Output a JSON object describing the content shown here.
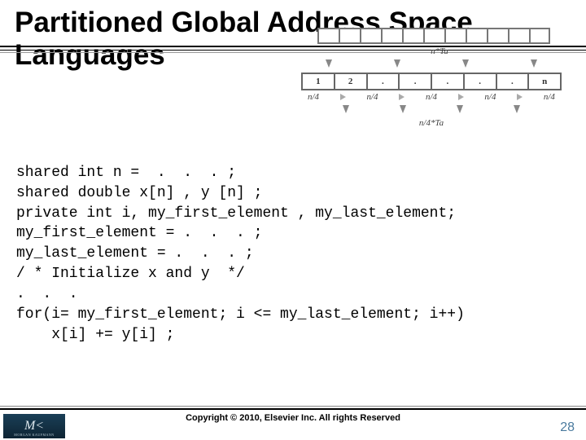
{
  "title": "Partitioned Global Address Space Languages",
  "diagram": {
    "top_label": "n*Ta",
    "mid_cells": [
      "1",
      "2",
      ".",
      ".",
      ".",
      ".",
      ".",
      "n"
    ],
    "n4_label": "n/4",
    "bottom_label": "n/4*Ta"
  },
  "code": "shared int n =  .  .  . ;\nshared double x[n] , y [n] ;\nprivate int i, my_first_element , my_last_element;\nmy_first_element = .  .  . ;\nmy_last_element = .  .  . ;\n/ * Initialize x and y  */\n.  .  .\nfor(i= my_first_element; i <= my_last_element; i++)\n    x[i] += y[i] ;",
  "footer": {
    "copyright": "Copyright © 2010, Elsevier Inc. All rights Reserved",
    "logo_main": "M<",
    "logo_sub": "MORGAN KAUFMANN",
    "page": "28"
  }
}
